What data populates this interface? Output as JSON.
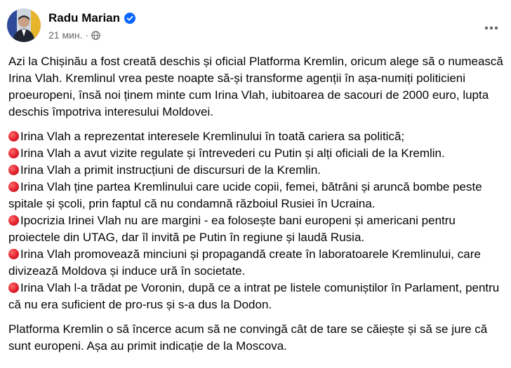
{
  "post": {
    "author": "Radu Marian",
    "time": "21 мин.",
    "separator": "·",
    "icons": {
      "verified": "verified-badge-icon",
      "audience": "globe-icon",
      "more": "more-options-icon"
    },
    "intro": "Azi la Chișinău a fost creată deschis și oficial Platforma Kremlin, oricum alege să o numească Irina Vlah. Kremlinul vrea peste noapte să-și transforme agenții în așa-numiți politicieni proeuropeni, însă noi ținem minte cum Irina Vlah, iubitoarea de sacouri de 2000 euro, lupta deschis împotriva interesului Moldovei.",
    "bullets": [
      "Irina Vlah a reprezentat interesele Kremlinului în toată cariera sa politică;",
      "Irina Vlah a avut vizite regulate și întrevederi cu Putin și alți oficiali de la Kremlin.",
      "Irina Vlah a primit instrucțiuni de discursuri de la Kremlin.",
      "Irina Vlah ține partea Kremlinului care ucide copii, femei, bătrâni și aruncă bombe peste spitale și școli, prin faptul că nu condamnă războiul Rusiei în Ucraina.",
      "Ipocrizia Irinei Vlah nu are margini - ea folosește bani europeni și americani pentru proiectele din UTAG, dar îl invită pe Putin în regiune și laudă Rusia.",
      "Irina Vlah promovează minciuni și propagandă create în laboratoarele Kremlinului, care divizează Moldova și induce ură în societate.",
      "Irina Vlah l-a trădat pe Voronin, după ce a intrat pe listele comuniștilor în Parlament, pentru că nu era suficient de pro-rus și s-a dus la Dodon."
    ],
    "outro": "Platforma Kremlin o să încerce acum să ne convingă cât de tare se căiește și să se jure că sunt europeni. Așa au primit indicație de la Moscova.",
    "colors": {
      "text": "#050505",
      "meta": "#65676b",
      "verified": "#0866ff",
      "bullet": "#e0202c"
    }
  }
}
